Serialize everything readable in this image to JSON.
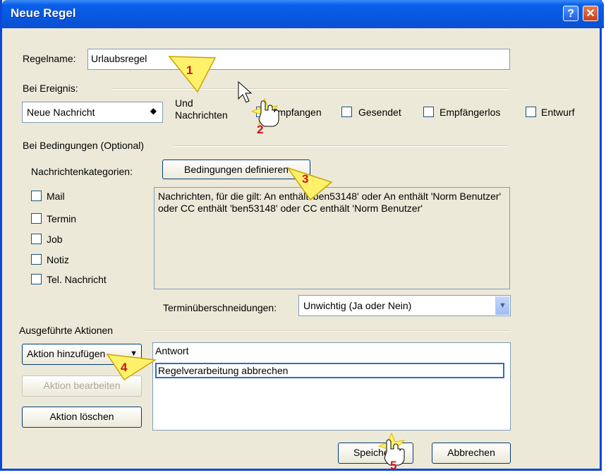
{
  "window": {
    "title": "Neue Regel"
  },
  "rule_name": {
    "label": "Regelname:",
    "value": "Urlaubsregel"
  },
  "event": {
    "section_label": "Bei Ereignis:",
    "selected": "Neue Nachricht",
    "und_label_line1": "Und",
    "und_label_line2": "Nachrichten",
    "checkboxes": [
      "Empfangen",
      "Gesendet",
      "Empfängerlos",
      "Entwurf"
    ]
  },
  "conditions": {
    "section_label": "Bei Bedingungen  (Optional)",
    "categories_label": "Nachrichtenkategorien:",
    "define_button": "Bedingungen definieren",
    "categories": [
      "Mail",
      "Termin",
      "Job",
      "Notiz",
      "Tel. Nachricht"
    ],
    "description": "Nachrichten, für die gilt: An  enthält 'ben53148' oder An  enthält 'Norm Benutzer' oder CC  enthält 'ben53148' oder CC  enthält 'Norm Benutzer'",
    "overlap_label": "Terminüberschneidungen:",
    "overlap_value": "Unwichtig (Ja oder Nein)"
  },
  "actions": {
    "section_label": "Ausgeführte Aktionen",
    "add_button": "Aktion hinzufügen",
    "edit_button": "Aktion bearbeiten",
    "delete_button": "Aktion löschen",
    "list": [
      "Antwort",
      "Regelverarbeitung abbrechen"
    ]
  },
  "footer": {
    "save_button": "Speichern",
    "cancel_button": "Abbrechen"
  },
  "steps": [
    "1",
    "2",
    "3",
    "4",
    "5"
  ],
  "colors": {
    "titlebar": "#0a5ee8",
    "dialog_bg": "#ece9d8",
    "step_marker": "#d01212",
    "highlight_yellow": "#fff26a"
  }
}
